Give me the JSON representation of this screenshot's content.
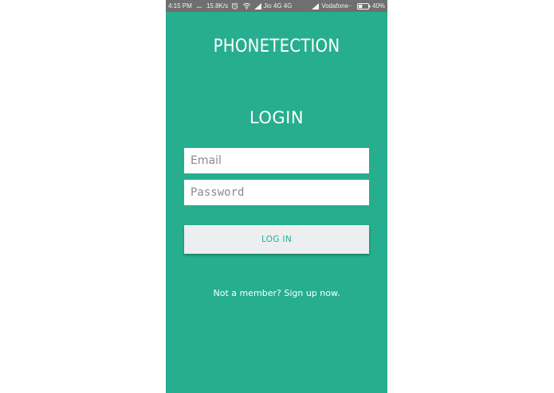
{
  "status_bar": {
    "time": "4:15 PM",
    "dots": "...",
    "net_speed": "15.8K/s",
    "carrier1": "Jio 4G 4G",
    "carrier2": "Vodafone",
    "carrier2_suffix": "··",
    "battery": "40%",
    "battery_level": 0.4,
    "icons": [
      "alarm-icon",
      "wifi-icon",
      "signal-icon",
      "signal-icon",
      "battery-icon"
    ]
  },
  "app": {
    "title": "PHONETECTION",
    "heading": "LOGIN"
  },
  "form": {
    "email_placeholder": "Email",
    "email_value": "",
    "password_placeholder": "Password",
    "password_value": "",
    "login_label": "LOG IN"
  },
  "footer": {
    "signup_text": "Not a member? Sign up now."
  },
  "colors": {
    "background": "#26ae8e",
    "status_bar": "#6f6f6f",
    "button_bg": "#eceef0",
    "button_text": "#26ae8e",
    "page_bg": "#ffffff"
  }
}
